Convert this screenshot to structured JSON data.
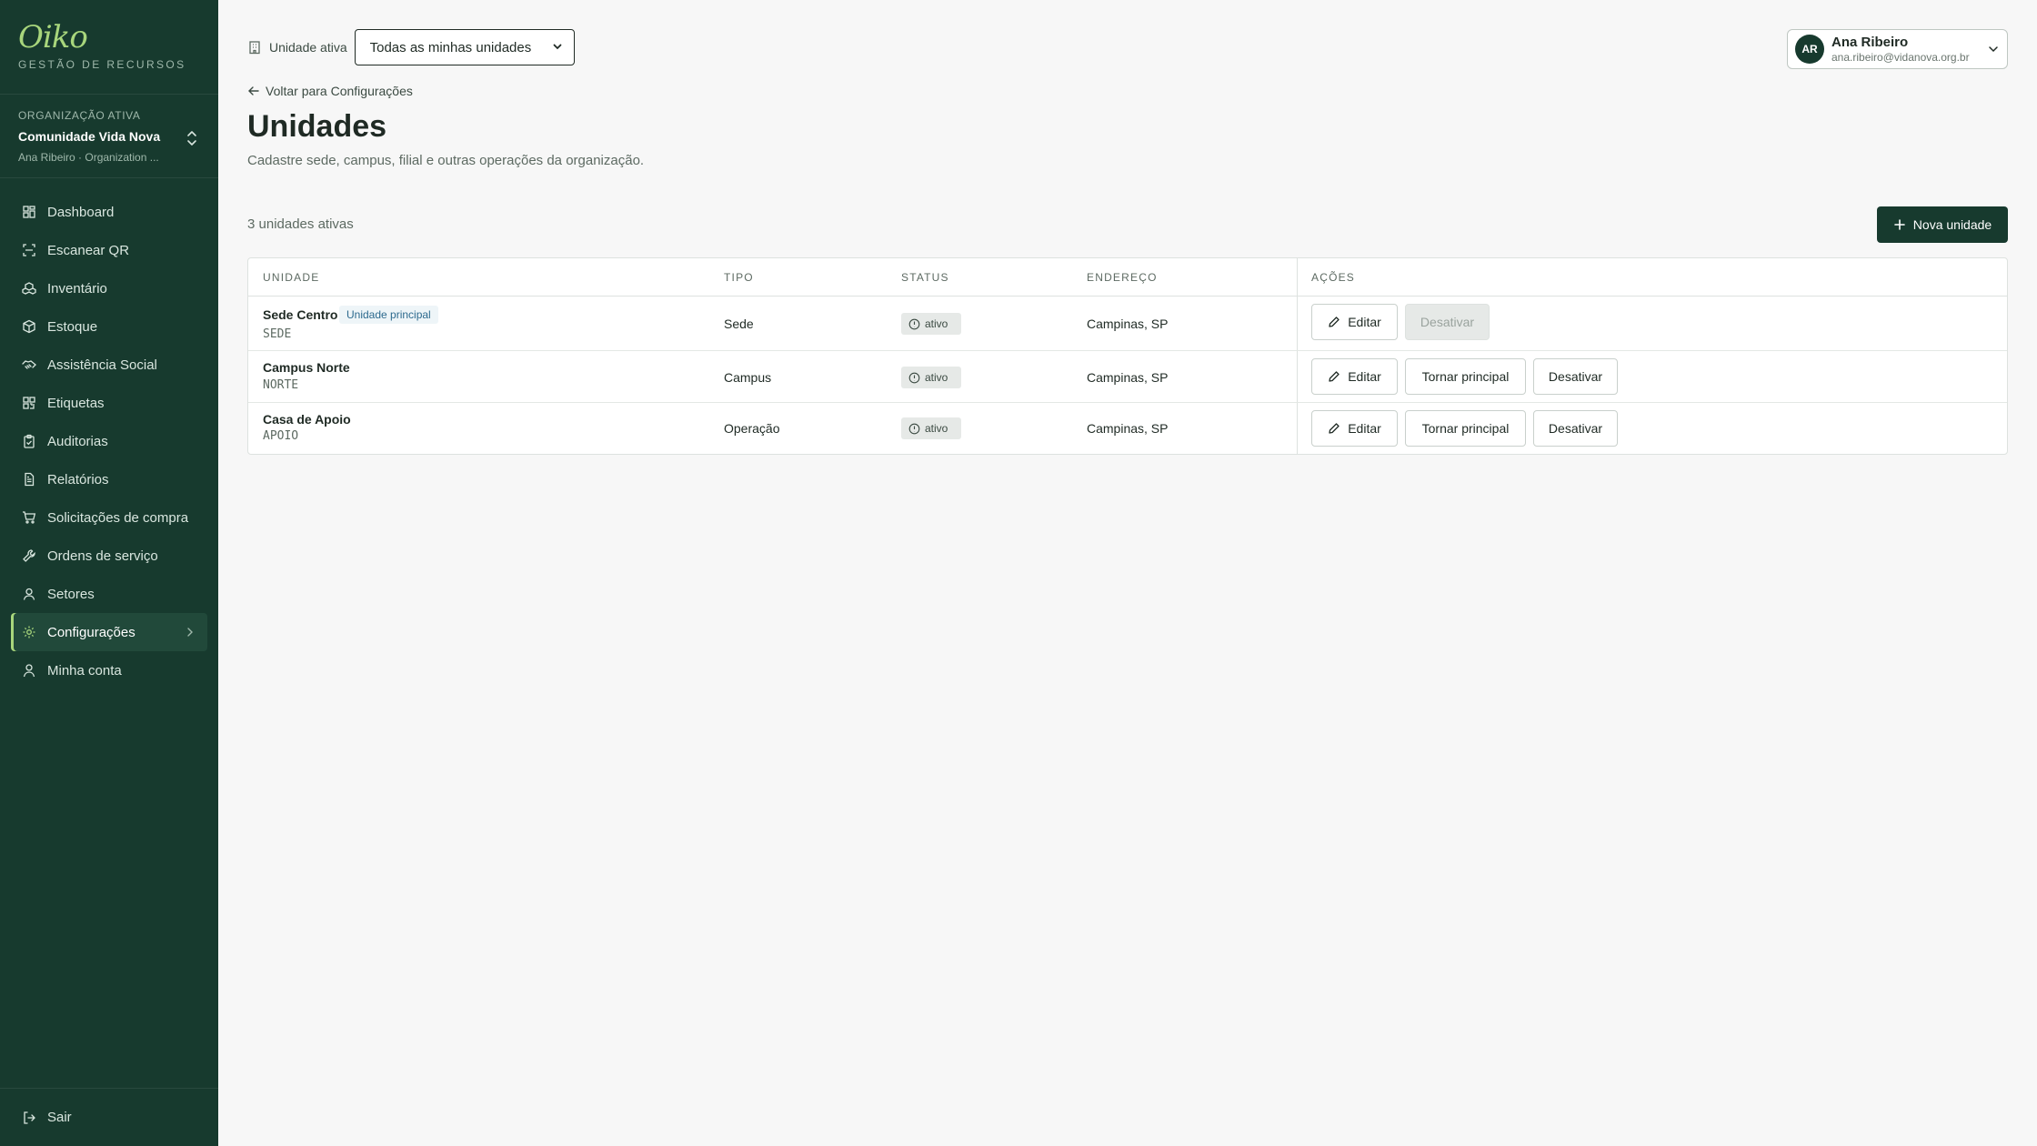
{
  "brand": {
    "logo": "Oiko",
    "subtitle": "GESTÃO DE RECURSOS"
  },
  "organization": {
    "label": "ORGANIZAÇÃO ATIVA",
    "name": "Comunidade Vida Nova",
    "user_line": "Ana Ribeiro · Organization ..."
  },
  "sidebar": {
    "items": [
      {
        "label": "Dashboard",
        "icon": "grid-icon"
      },
      {
        "label": "Escanear QR",
        "icon": "scan-icon"
      },
      {
        "label": "Inventário",
        "icon": "boxes-icon"
      },
      {
        "label": "Estoque",
        "icon": "package-icon"
      },
      {
        "label": "Assistência Social",
        "icon": "handshake-icon"
      },
      {
        "label": "Etiquetas",
        "icon": "qr-icon"
      },
      {
        "label": "Auditorias",
        "icon": "clipboard-icon"
      },
      {
        "label": "Relatórios",
        "icon": "file-icon"
      },
      {
        "label": "Solicitações de compra",
        "icon": "cart-icon"
      },
      {
        "label": "Ordens de serviço",
        "icon": "wrench-icon"
      },
      {
        "label": "Setores",
        "icon": "users-icon"
      },
      {
        "label": "Configurações",
        "icon": "gear-icon",
        "active": true
      },
      {
        "label": "Minha conta",
        "icon": "user-icon"
      }
    ],
    "logout_label": "Sair"
  },
  "topbar": {
    "unit_label": "Unidade ativa",
    "unit_select_value": "Todas as minhas unidades"
  },
  "user": {
    "initials": "AR",
    "name": "Ana Ribeiro",
    "email": "ana.ribeiro@vidanova.org.br"
  },
  "page": {
    "back_label": "Voltar para Configurações",
    "title": "Unidades",
    "subtitle": "Cadastre sede, campus, filial e outras operações da organização.",
    "count_label": "3 unidades ativas",
    "new_button_label": "Nova unidade"
  },
  "table": {
    "headers": [
      "UNIDADE",
      "TIPO",
      "STATUS",
      "ENDEREÇO",
      "AÇÕES"
    ],
    "rows": [
      {
        "name": "Sede Centro",
        "code": "SEDE",
        "badge": "Unidade principal",
        "type": "Sede",
        "status": "ativo",
        "address": "Campinas, SP",
        "edit": "Editar",
        "make_principal": "",
        "deactivate": "Desativar",
        "deactivate_disabled": true
      },
      {
        "name": "Campus Norte",
        "code": "NORTE",
        "badge": "",
        "type": "Campus",
        "status": "ativo",
        "address": "Campinas, SP",
        "edit": "Editar",
        "make_principal": "Tornar principal",
        "deactivate": "Desativar",
        "deactivate_disabled": false
      },
      {
        "name": "Casa de Apoio",
        "code": "APOIO",
        "badge": "",
        "type": "Operação",
        "status": "ativo",
        "address": "Campinas, SP",
        "edit": "Editar",
        "make_principal": "Tornar principal",
        "deactivate": "Desativar",
        "deactivate_disabled": false
      }
    ]
  },
  "colors": {
    "sidebar_bg": "#173a2e",
    "accent": "#a8d67c",
    "primary_button": "#173a2e"
  }
}
